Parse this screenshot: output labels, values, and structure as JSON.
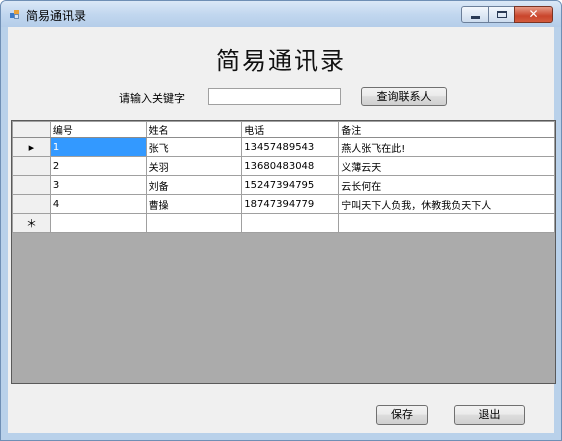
{
  "window": {
    "title": "简易通讯录"
  },
  "heading": "简易通讯录",
  "search": {
    "label": "请输入关键字",
    "value": "",
    "button_label": "查询联系人"
  },
  "grid": {
    "columns": [
      "编号",
      "姓名",
      "电话",
      "备注"
    ],
    "rows": [
      [
        "1",
        "张飞",
        "13457489543",
        "燕人张飞在此!"
      ],
      [
        "2",
        "关羽",
        "13680483048",
        "义薄云天"
      ],
      [
        "3",
        "刘备",
        "15247394795",
        "云长何在"
      ],
      [
        "4",
        "曹操",
        "18747394779",
        "宁叫天下人负我，休教我负天下人"
      ]
    ],
    "row_markers": [
      "▸",
      "",
      "",
      "",
      "＊"
    ]
  },
  "footer": {
    "save_label": "保存",
    "exit_label": "退出"
  }
}
